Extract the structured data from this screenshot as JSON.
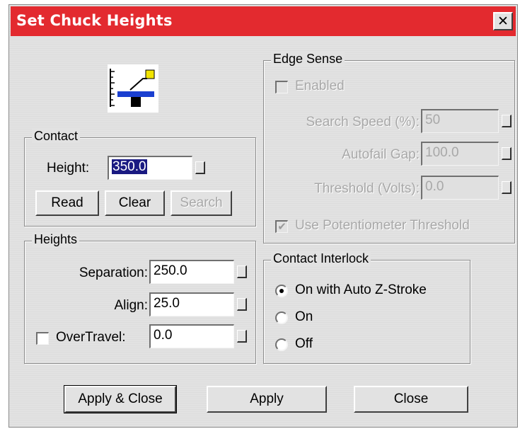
{
  "window": {
    "title": "Set Chuck Heights",
    "close_glyph": "✕"
  },
  "icon": {
    "name": "chuck-height-icon",
    "accent_colors": [
      "#f2e400",
      "#1a3fd0",
      "#000000"
    ]
  },
  "contact": {
    "legend": "Contact",
    "height_label": "Height:",
    "height_value": "350.0",
    "buttons": {
      "read": "Read",
      "clear": "Clear",
      "search": "Search"
    }
  },
  "heights": {
    "legend": "Heights",
    "separation_label": "Separation:",
    "separation_value": "250.0",
    "align_label": "Align:",
    "align_value": "25.0",
    "overtravel_label": "OverTravel:",
    "overtravel_value": "0.0",
    "overtravel_checked": false
  },
  "edge_sense": {
    "legend": "Edge Sense",
    "enabled_label": "Enabled",
    "search_speed_label": "Search Speed (%):",
    "search_speed_value": "50",
    "autofail_gap_label": "Autofail Gap:",
    "autofail_gap_value": "100.0",
    "threshold_label": "Threshold (Volts):",
    "threshold_value": "0.0",
    "use_pot_label": "Use Potentiometer Threshold"
  },
  "contact_interlock": {
    "legend": "Contact Interlock",
    "options": [
      "On with Auto Z-Stroke",
      "On",
      "Off"
    ],
    "selected": "On with Auto Z-Stroke"
  },
  "footer": {
    "apply_close": "Apply & Close",
    "apply": "Apply",
    "close": "Close"
  },
  "colors": {
    "titlebar": "#e32a2f",
    "dialog_bg": "#e2e2e2",
    "selection": "#1a1a82",
    "disabled_text": "#a8a8a8"
  }
}
